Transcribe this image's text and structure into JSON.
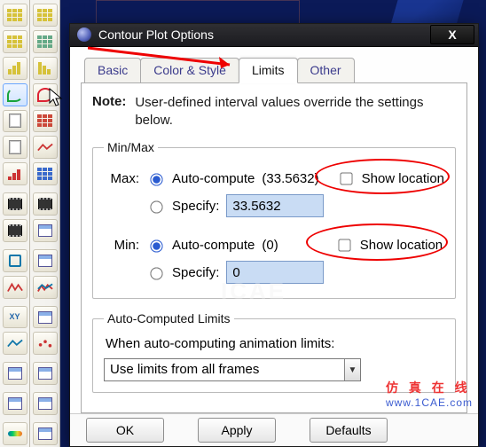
{
  "dialog": {
    "title": "Contour Plot Options",
    "close_glyph": "X",
    "tabs": {
      "basic": "Basic",
      "color": "Color & Style",
      "limits": "Limits",
      "other": "Other"
    },
    "note": {
      "label": "Note:",
      "text": "User-defined interval values override the settings below."
    },
    "minmax": {
      "legend": "Min/Max",
      "max_label": "Max:",
      "min_label": "Min:",
      "auto_label": "Auto-compute",
      "specify_label": "Specify:",
      "show_loc_label": "Show location",
      "max_auto_value": "(33.5632)",
      "max_specify_value": "33.5632",
      "min_auto_value": "(0)",
      "min_specify_value": "0"
    },
    "acl": {
      "legend": "Auto-Computed Limits",
      "desc": "When auto-computing animation limits:",
      "combo_value": "Use limits from all frames"
    },
    "buttons": {
      "ok": "OK",
      "apply": "Apply",
      "defaults": "Defaults"
    }
  },
  "watermark": {
    "cn": "仿 真 在 线",
    "en": "www.1CAE.com"
  }
}
